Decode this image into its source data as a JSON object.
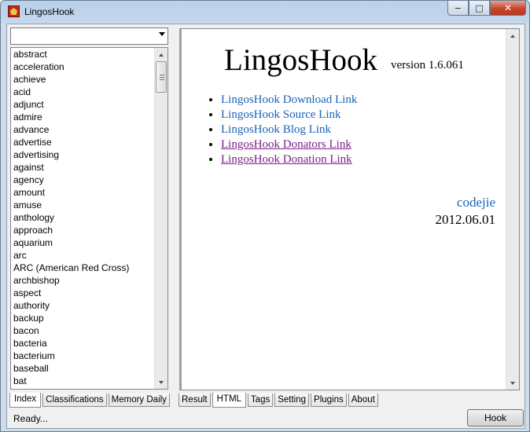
{
  "window": {
    "title": "LingosHook",
    "buttons": {
      "minimize": "−",
      "maximize": "□",
      "close": "✕"
    }
  },
  "left_panel": {
    "combo_value": "",
    "words": [
      "abstract",
      "acceleration",
      "achieve",
      "acid",
      "adjunct",
      "admire",
      "advance",
      "advertise",
      "advertising",
      "against",
      "agency",
      "amount",
      "amuse",
      "anthology",
      "approach",
      "aquarium",
      "arc",
      "ARC (American Red Cross)",
      "archbishop",
      "aspect",
      "authority",
      "backup",
      "bacon",
      "bacteria",
      "bacterium",
      "baseball",
      "bat"
    ],
    "tabs": [
      "Index",
      "Classifications",
      "Memory Daily"
    ],
    "active_tab": "Index"
  },
  "right_panel": {
    "heading": "LingosHook",
    "version": "version 1.6.061",
    "links": [
      {
        "text": "LingosHook Download Link",
        "visited": false
      },
      {
        "text": "LingosHook Source Link",
        "visited": false
      },
      {
        "text": "LingosHook Blog Link",
        "visited": false
      },
      {
        "text": "LingosHook Donators Link",
        "visited": true
      },
      {
        "text": "LingosHook Donation Link",
        "visited": true
      }
    ],
    "author": "codejie",
    "date": "2012.06.01",
    "tabs": [
      "Result",
      "HTML",
      "Tags",
      "Setting",
      "Plugins",
      "About"
    ],
    "active_tab": "HTML"
  },
  "status": {
    "text": "Ready...",
    "hook_button": "Hook"
  },
  "colors": {
    "link": "#1a63b9",
    "visited": "#7a1f88",
    "title_bar": "#c4d7ec"
  }
}
